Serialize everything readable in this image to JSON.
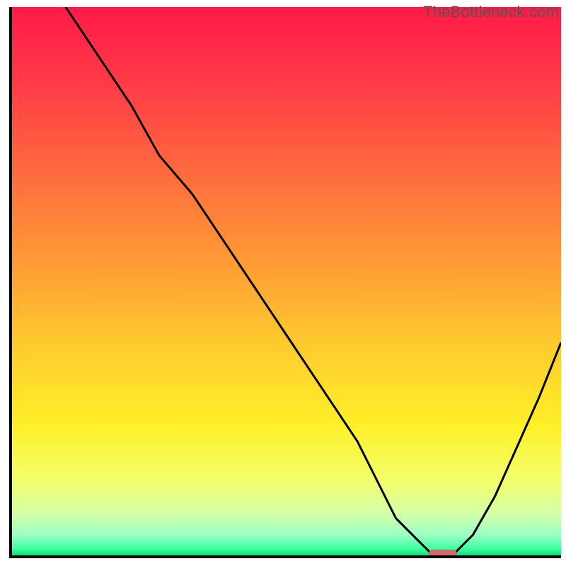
{
  "watermark": "TheBottleneck.com",
  "chart_data": {
    "type": "line",
    "title": "",
    "xlabel": "",
    "ylabel": "",
    "xlim": [
      0,
      100
    ],
    "ylim": [
      0,
      100
    ],
    "annotations": [],
    "note": "Values are estimated from the rendered curve; no axis tick labels are visible. x,y are in percent of the plot area (0=left/bottom, 100=right/top).",
    "series": [
      {
        "name": "bottleneck-curve",
        "x": [
          10,
          16,
          22,
          27,
          33,
          39,
          45,
          51,
          57,
          63,
          67,
          70,
          74,
          77,
          80,
          84,
          88,
          92,
          96,
          100
        ],
        "y": [
          100,
          91,
          82,
          73,
          66,
          57,
          48,
          39,
          30,
          21,
          13,
          7,
          3,
          0,
          0,
          4,
          11,
          20,
          29,
          39
        ]
      }
    ],
    "marker": {
      "name": "optimal-zone-marker",
      "x_center": 78.5,
      "y": 0.6,
      "width": 5,
      "color": "#d46a6a"
    },
    "background_gradient": {
      "direction": "vertical",
      "stops": [
        {
          "pos": 0.0,
          "color": "#ff1a47"
        },
        {
          "pos": 0.14,
          "color": "#ff3b47"
        },
        {
          "pos": 0.3,
          "color": "#ff6a3e"
        },
        {
          "pos": 0.46,
          "color": "#ff9a36"
        },
        {
          "pos": 0.62,
          "color": "#ffcc2e"
        },
        {
          "pos": 0.76,
          "color": "#fff028"
        },
        {
          "pos": 0.86,
          "color": "#f3ff6a"
        },
        {
          "pos": 0.92,
          "color": "#d6ffa8"
        },
        {
          "pos": 0.96,
          "color": "#9dffc5"
        },
        {
          "pos": 0.985,
          "color": "#3fffa0"
        },
        {
          "pos": 1.0,
          "color": "#04d873"
        }
      ]
    },
    "axes_color": "#000000",
    "plot_inset": {
      "left": 15,
      "right": 7,
      "top": 10,
      "bottom": 13
    }
  }
}
